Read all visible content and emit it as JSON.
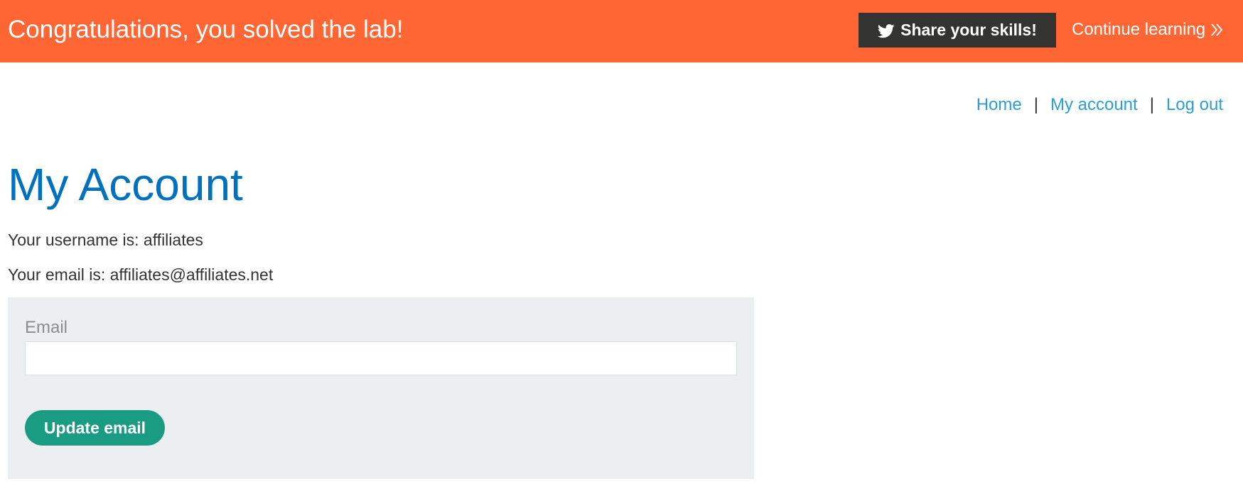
{
  "banner": {
    "title": "Congratulations, you solved the lab!",
    "share_label": "Share your skills!",
    "continue_label": "Continue learning",
    "background_color": "#ff6633"
  },
  "nav": {
    "home": "Home",
    "my_account": "My account",
    "log_out": "Log out",
    "separator": "|"
  },
  "main": {
    "title": "My Account",
    "username_line": "Your username is: affiliates",
    "email_line": "Your email is: affiliates@affiliates.net"
  },
  "form": {
    "email_label": "Email",
    "email_value": "",
    "submit_label": "Update email",
    "button_color": "#1a9c82"
  },
  "icons": {
    "share": "twitter-icon",
    "continue": "chevrons-right-icon"
  }
}
